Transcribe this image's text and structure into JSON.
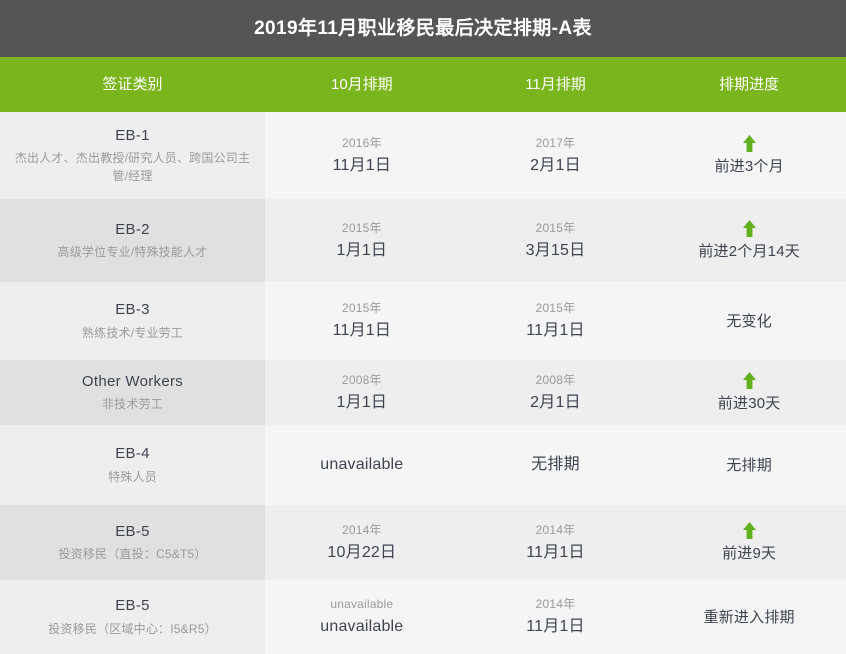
{
  "header": {
    "title": "2019年11月职业移民最后决定排期-A表",
    "bar_color": "#555555"
  },
  "table": {
    "accent_color": "#7ab51d",
    "arrow_color": "#62b01e",
    "columns": [
      {
        "key": "category",
        "label": "签证类别"
      },
      {
        "key": "october",
        "label": "10月排期"
      },
      {
        "key": "november",
        "label": "11月排期"
      },
      {
        "key": "progress",
        "label": "排期进度"
      }
    ],
    "rows": [
      {
        "category_name": "EB-1",
        "category_desc": "杰出人才、杰出教授/研究人员、跨国公司主管/经理",
        "october_year": "2016年",
        "october_date": "11月1日",
        "november_year": "2017年",
        "november_date": "2月1日",
        "progress_text": "前进3个月",
        "progress_arrow": "arrow-up-icon"
      },
      {
        "category_name": "EB-2",
        "category_desc": "高级学位专业/特殊技能人才",
        "october_year": "2015年",
        "october_date": "1月1日",
        "november_year": "2015年",
        "november_date": "3月15日",
        "progress_text": "前进2个月14天",
        "progress_arrow": "arrow-up-icon"
      },
      {
        "category_name": "EB-3",
        "category_desc": "熟练技术/专业劳工",
        "october_year": "2015年",
        "october_date": "11月1日",
        "november_year": "2015年",
        "november_date": "11月1日",
        "progress_text": "无变化",
        "progress_arrow": ""
      },
      {
        "category_name": "Other Workers",
        "category_desc": "非技术劳工",
        "october_year": "2008年",
        "october_date": "1月1日",
        "november_year": "2008年",
        "november_date": "2月1日",
        "progress_text": "前进30天",
        "progress_arrow": "arrow-up-icon"
      },
      {
        "category_name": "EB-4",
        "category_desc": "特殊人员",
        "october_year": "",
        "october_date": "unavailable",
        "november_year": "",
        "november_date": "无排期",
        "progress_text": "无排期",
        "progress_arrow": ""
      },
      {
        "category_name": "EB-5",
        "category_desc": "投资移民（直投：C5&T5）",
        "october_year": "2014年",
        "october_date": "10月22日",
        "november_year": "2014年",
        "november_date": "11月1日",
        "progress_text": "前进9天",
        "progress_arrow": "arrow-up-icon"
      },
      {
        "category_name": "EB-5",
        "category_desc": "投资移民（区域中心：I5&R5）",
        "october_year": "unavailable",
        "october_date": "unavailable",
        "november_year": "2014年",
        "november_date": "11月1日",
        "progress_text": "重新进入排期",
        "progress_arrow": ""
      }
    ]
  }
}
